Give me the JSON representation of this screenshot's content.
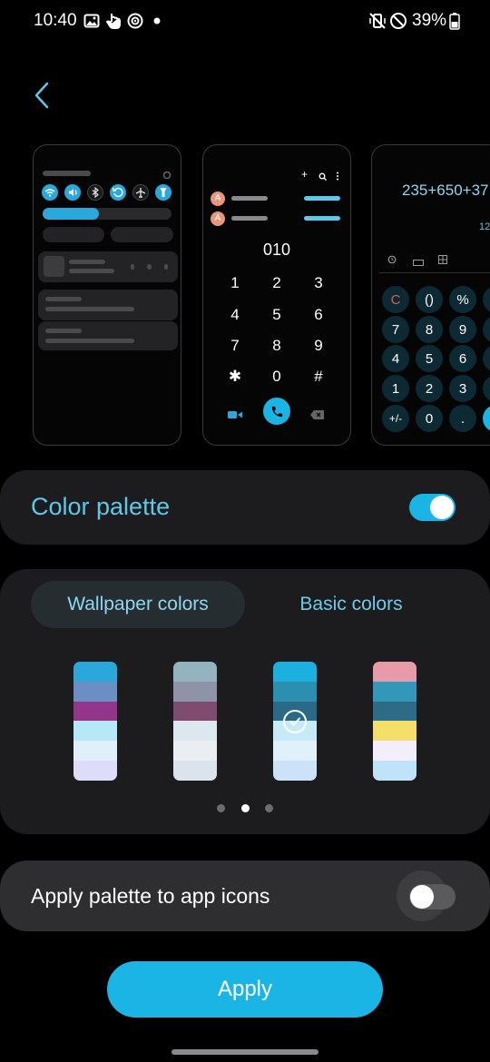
{
  "status_bar": {
    "time": "10:40",
    "battery": "39%",
    "icons": [
      "image-icon",
      "hand-touch-icon",
      "sync-target-icon",
      "dot-icon",
      "vibrate-off-icon",
      "do-not-disturb-icon",
      "battery-icon"
    ]
  },
  "back_icon": "chevron-left-icon",
  "previews": {
    "quick_panel": {
      "icon_color": "#2aa8dc"
    },
    "dialer": {
      "number": "010",
      "avatar_letter": "A",
      "keys": [
        "1",
        "2",
        "3",
        "4",
        "5",
        "6",
        "7",
        "8",
        "9",
        "✱",
        "0",
        "#"
      ]
    },
    "calculator": {
      "expression": "235+650+37",
      "result_partial": "12",
      "keys": [
        "C",
        "()",
        "%",
        "7",
        "8",
        "9",
        "4",
        "5",
        "6",
        "1",
        "2",
        "3",
        "+/-",
        "0",
        "."
      ]
    }
  },
  "palette_toggle": {
    "label": "Color palette",
    "enabled": true,
    "accent": "#1ab5e4"
  },
  "tabs": {
    "wallpaper": "Wallpaper colors",
    "basic": "Basic colors",
    "selected": "wallpaper"
  },
  "swatches": [
    {
      "colors": [
        "#2aa8dc",
        "#6b8fc4",
        "#94358c",
        "#b6e8f7",
        "#dff0fb",
        "#dedcf8"
      ],
      "selected": false
    },
    {
      "colors": [
        "#93b4be",
        "#8e93a8",
        "#7f4b6e",
        "#dce7f0",
        "#eaeef2",
        "#dbe4ec"
      ],
      "selected": false
    },
    {
      "colors": [
        "#1cb0e0",
        "#2b8fb2",
        "#2a6a86",
        "#c5ebf8",
        "#e0f1fb",
        "#cce2f8"
      ],
      "selected": true
    },
    {
      "colors": [
        "#e79aa8",
        "#3397ba",
        "#2d6c84",
        "#f4df6b",
        "#f3eefa",
        "#bfe3f8"
      ],
      "selected": false
    }
  ],
  "pager": {
    "count": 3,
    "active_index": 1
  },
  "app_icons_toggle": {
    "label": "Apply palette to app icons",
    "enabled": false
  },
  "apply_button": {
    "label": "Apply"
  }
}
